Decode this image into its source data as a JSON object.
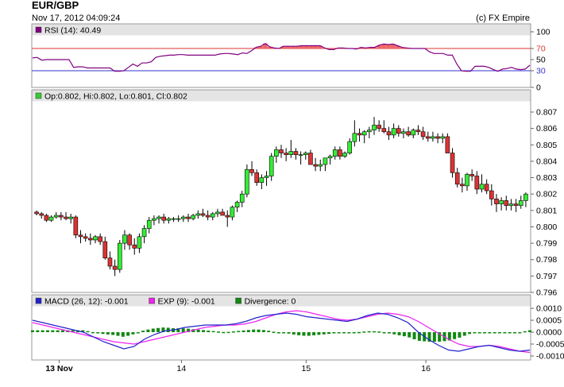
{
  "header": {
    "symbol": "EUR/GBP",
    "datetime": "Nov 17, 2012 04:09:24",
    "copyright": "(c) FX Empire"
  },
  "chart_data": [
    {
      "id": "rsi",
      "type": "line",
      "legend": "RSI (14): 40.49",
      "legend_color": "#800080",
      "line_color": "#800080",
      "ylim": [
        0,
        100
      ],
      "yticks": [
        "100",
        "70",
        "50",
        "30",
        "0"
      ],
      "levels": [
        70,
        30
      ],
      "level_colors": [
        "#dd3333",
        "#3333cc"
      ],
      "values": [
        53,
        54,
        49,
        50,
        50,
        50,
        50,
        50,
        50,
        36,
        37,
        37,
        35,
        35,
        35,
        35,
        35,
        35,
        29,
        29,
        30,
        36,
        42,
        38,
        44,
        44,
        46,
        54,
        56,
        57,
        58,
        58,
        59,
        59,
        58,
        58,
        58,
        58,
        58,
        58,
        58,
        60,
        61,
        61,
        60,
        59,
        62,
        61,
        66,
        72,
        74,
        79,
        73,
        71,
        70,
        74,
        74,
        74,
        74,
        75,
        75,
        75,
        75,
        75,
        71,
        68,
        68,
        71,
        71,
        70,
        70,
        69,
        72,
        71,
        72,
        72,
        76,
        78,
        77,
        78,
        75,
        72,
        71,
        70,
        70,
        70,
        70,
        64,
        61,
        61,
        61,
        58,
        58,
        42,
        30,
        29,
        29,
        38,
        38,
        38,
        36,
        32,
        29,
        33,
        34,
        36,
        33,
        32,
        33,
        40
      ]
    },
    {
      "id": "price",
      "type": "candlestick",
      "legend": "Op:0.802, Hi:0.802, Lo:0.801, Cl:0.802",
      "legend_color": "#33cc33",
      "up_color": "#33ee33",
      "down_color": "#dd3333",
      "ylim": [
        0.796,
        0.8075
      ],
      "yticks": [
        "0.807",
        "0.806",
        "0.805",
        "0.804",
        "0.803",
        "0.802",
        "0.801",
        "0.800",
        "0.799",
        "0.798",
        "0.797",
        "0.796"
      ],
      "ohlc": [
        [
          0.8009,
          0.801,
          0.8007,
          0.8008
        ],
        [
          0.8008,
          0.8009,
          0.8005,
          0.8007
        ],
        [
          0.8007,
          0.8008,
          0.8003,
          0.8004
        ],
        [
          0.8004,
          0.8007,
          0.8003,
          0.8006
        ],
        [
          0.8006,
          0.8009,
          0.8005,
          0.8007
        ],
        [
          0.8007,
          0.8009,
          0.8004,
          0.8006
        ],
        [
          0.8006,
          0.8009,
          0.8004,
          0.8005
        ],
        [
          0.8005,
          0.8008,
          0.8002,
          0.8006
        ],
        [
          0.8006,
          0.8007,
          0.7993,
          0.7995
        ],
        [
          0.7995,
          0.7998,
          0.799,
          0.7994
        ],
        [
          0.7994,
          0.7996,
          0.7991,
          0.7993
        ],
        [
          0.7993,
          0.7996,
          0.7989,
          0.7992
        ],
        [
          0.7992,
          0.7995,
          0.799,
          0.7994
        ],
        [
          0.7994,
          0.7996,
          0.7989,
          0.7991
        ],
        [
          0.7991,
          0.7994,
          0.798,
          0.7981
        ],
        [
          0.7981,
          0.7985,
          0.7974,
          0.7976
        ],
        [
          0.7976,
          0.798,
          0.797,
          0.7974
        ],
        [
          0.7974,
          0.7992,
          0.7972,
          0.799
        ],
        [
          0.799,
          0.7998,
          0.7986,
          0.7995
        ],
        [
          0.7995,
          0.7996,
          0.7986,
          0.7989
        ],
        [
          0.7989,
          0.7993,
          0.7983,
          0.7987
        ],
        [
          0.7987,
          0.7996,
          0.7984,
          0.7994
        ],
        [
          0.7994,
          0.8001,
          0.799,
          0.7999
        ],
        [
          0.7999,
          0.8006,
          0.7996,
          0.8004
        ],
        [
          0.8004,
          0.8007,
          0.8001,
          0.8005
        ],
        [
          0.8005,
          0.8007,
          0.8002,
          0.8006
        ],
        [
          0.8006,
          0.8008,
          0.8002,
          0.8004
        ],
        [
          0.8004,
          0.8006,
          0.8002,
          0.8005
        ],
        [
          0.8005,
          0.8006,
          0.8003,
          0.8005
        ],
        [
          0.8005,
          0.8007,
          0.8003,
          0.8005
        ],
        [
          0.8005,
          0.8007,
          0.8003,
          0.8006
        ],
        [
          0.8006,
          0.8008,
          0.8003,
          0.8005
        ],
        [
          0.8005,
          0.8008,
          0.8004,
          0.8007
        ],
        [
          0.8007,
          0.801,
          0.8005,
          0.8008
        ],
        [
          0.8008,
          0.8011,
          0.8006,
          0.8007
        ],
        [
          0.8007,
          0.801,
          0.8004,
          0.8006
        ],
        [
          0.8006,
          0.8009,
          0.8004,
          0.8008
        ],
        [
          0.8008,
          0.8011,
          0.8006,
          0.8009
        ],
        [
          0.8009,
          0.8011,
          0.8007,
          0.8007
        ],
        [
          0.8007,
          0.801,
          0.8,
          0.8006
        ],
        [
          0.8006,
          0.8013,
          0.8004,
          0.8012
        ],
        [
          0.8012,
          0.8016,
          0.8009,
          0.8015
        ],
        [
          0.8015,
          0.8022,
          0.8012,
          0.802
        ],
        [
          0.802,
          0.8038,
          0.8018,
          0.8035
        ],
        [
          0.8035,
          0.804,
          0.8031,
          0.8033
        ],
        [
          0.8033,
          0.8035,
          0.8025,
          0.8027
        ],
        [
          0.8027,
          0.8032,
          0.8023,
          0.803
        ],
        [
          0.803,
          0.8034,
          0.8025,
          0.8031
        ],
        [
          0.8031,
          0.8045,
          0.8028,
          0.8043
        ],
        [
          0.8043,
          0.8049,
          0.8039,
          0.8047
        ],
        [
          0.8047,
          0.805,
          0.8042,
          0.8045
        ],
        [
          0.8045,
          0.8048,
          0.804,
          0.8044
        ],
        [
          0.8044,
          0.8053,
          0.8042,
          0.8046
        ],
        [
          0.8046,
          0.8048,
          0.8041,
          0.8044
        ],
        [
          0.8044,
          0.8046,
          0.8038,
          0.8044
        ],
        [
          0.8044,
          0.8046,
          0.8041,
          0.8045
        ],
        [
          0.8045,
          0.8047,
          0.8039,
          0.8038
        ],
        [
          0.8038,
          0.8042,
          0.8034,
          0.8037
        ],
        [
          0.8037,
          0.8041,
          0.8034,
          0.8038
        ],
        [
          0.8038,
          0.8042,
          0.8034,
          0.8042
        ],
        [
          0.8042,
          0.8044,
          0.8038,
          0.8043
        ],
        [
          0.8043,
          0.8049,
          0.8041,
          0.8047
        ],
        [
          0.8047,
          0.8049,
          0.8041,
          0.8043
        ],
        [
          0.8043,
          0.8046,
          0.8042,
          0.8045
        ],
        [
          0.8045,
          0.8054,
          0.8044,
          0.8052
        ],
        [
          0.8052,
          0.8065,
          0.8049,
          0.8057
        ],
        [
          0.8057,
          0.806,
          0.8052,
          0.8056
        ],
        [
          0.8056,
          0.8059,
          0.8051,
          0.8058
        ],
        [
          0.8058,
          0.8061,
          0.8054,
          0.8059
        ],
        [
          0.8059,
          0.8067,
          0.8056,
          0.8062
        ],
        [
          0.8062,
          0.8065,
          0.8058,
          0.806
        ],
        [
          0.806,
          0.8065,
          0.8057,
          0.8058
        ],
        [
          0.8058,
          0.8061,
          0.8053,
          0.8056
        ],
        [
          0.8056,
          0.8063,
          0.8054,
          0.806
        ],
        [
          0.806,
          0.8062,
          0.8055,
          0.8057
        ],
        [
          0.8057,
          0.806,
          0.8054,
          0.8058
        ],
        [
          0.8058,
          0.8061,
          0.8055,
          0.8056
        ],
        [
          0.8056,
          0.806,
          0.8054,
          0.8059
        ],
        [
          0.8059,
          0.8062,
          0.8056,
          0.8058
        ],
        [
          0.8058,
          0.8061,
          0.8053,
          0.8055
        ],
        [
          0.8055,
          0.8058,
          0.8052,
          0.8054
        ],
        [
          0.8054,
          0.8058,
          0.8052,
          0.8055
        ],
        [
          0.8055,
          0.8057,
          0.8051,
          0.8054
        ],
        [
          0.8054,
          0.8057,
          0.8051,
          0.8055
        ],
        [
          0.8055,
          0.8057,
          0.8048,
          0.8045
        ],
        [
          0.8045,
          0.8048,
          0.803,
          0.8033
        ],
        [
          0.8033,
          0.8036,
          0.8024,
          0.8026
        ],
        [
          0.8026,
          0.803,
          0.8021,
          0.8025
        ],
        [
          0.8025,
          0.8033,
          0.8022,
          0.8032
        ],
        [
          0.8032,
          0.8035,
          0.8028,
          0.8031
        ],
        [
          0.8031,
          0.8034,
          0.802,
          0.8023
        ],
        [
          0.8023,
          0.8032,
          0.8021,
          0.8026
        ],
        [
          0.8026,
          0.8029,
          0.802,
          0.8022
        ],
        [
          0.8022,
          0.8026,
          0.8013,
          0.8017
        ],
        [
          0.8017,
          0.802,
          0.8009,
          0.8014
        ],
        [
          0.8014,
          0.8018,
          0.801,
          0.8016
        ],
        [
          0.8016,
          0.8019,
          0.801,
          0.8013
        ],
        [
          0.8013,
          0.8017,
          0.801,
          0.8014
        ],
        [
          0.8014,
          0.8017,
          0.8009,
          0.8013
        ],
        [
          0.8013,
          0.8019,
          0.8011,
          0.8016
        ],
        [
          0.8016,
          0.8021,
          0.8012,
          0.802
        ]
      ]
    },
    {
      "id": "macd",
      "type": "line",
      "legend": [
        {
          "label": "MACD (26, 12): -0.001",
          "color": "#2222cc"
        },
        {
          "label": "EXP (9): -0.001",
          "color": "#ee22ee"
        },
        {
          "label": "Divergence: 0",
          "color": "#118811"
        }
      ],
      "ylim": [
        -0.0011,
        0.0011
      ],
      "yticks": [
        "0.0010",
        "0.0005",
        "0.0000",
        "-0.0005",
        "-0.0010"
      ],
      "macd": [
        0.0005,
        0.0004,
        0.0003,
        0.0002,
        0.0001,
        0.0,
        -0.0002,
        -0.0004,
        -0.00055,
        -0.0007,
        -0.0006,
        -0.0003,
        -0.0001,
        5e-05,
        0.0001,
        0.0002,
        0.00025,
        0.0003,
        0.0003,
        0.0003,
        0.00035,
        0.00045,
        0.0006,
        0.0007,
        0.00075,
        0.0008,
        0.00075,
        0.00065,
        0.0006,
        0.00055,
        0.0005,
        0.00045,
        0.00055,
        0.0007,
        0.0008,
        0.00075,
        0.0006,
        0.0004,
        0.0,
        -0.0003,
        -0.00055,
        -0.00075,
        -0.0008,
        -0.0007,
        -0.0006,
        -0.00055,
        -0.00065,
        -0.00075,
        -0.0008,
        -0.00075
      ],
      "signal": [
        0.0004,
        0.0003,
        0.0002,
        0.0001,
        0.0,
        -0.0001,
        -0.0002,
        -0.0003,
        -0.0004,
        -0.00045,
        -0.0005,
        -0.0004,
        -0.0003,
        -0.0002,
        -0.0001,
        0.0,
        0.0001,
        0.0002,
        0.00025,
        0.0003,
        0.0003,
        0.00035,
        0.00045,
        0.0006,
        0.00075,
        0.00085,
        0.0009,
        0.00085,
        0.00075,
        0.00065,
        0.00055,
        0.0005,
        0.00055,
        0.00065,
        0.00075,
        0.0008,
        0.00075,
        0.00065,
        0.00045,
        0.0002,
        -5e-05,
        -0.0003,
        -0.0005,
        -0.0006,
        -0.0006,
        -0.00055,
        -0.0006,
        -0.0007,
        -0.0008,
        -0.00085
      ],
      "x_labels": [
        "13 Nov",
        "14",
        "15",
        "16"
      ],
      "x_label_fracs": [
        0.055,
        0.3,
        0.55,
        0.79
      ]
    }
  ]
}
